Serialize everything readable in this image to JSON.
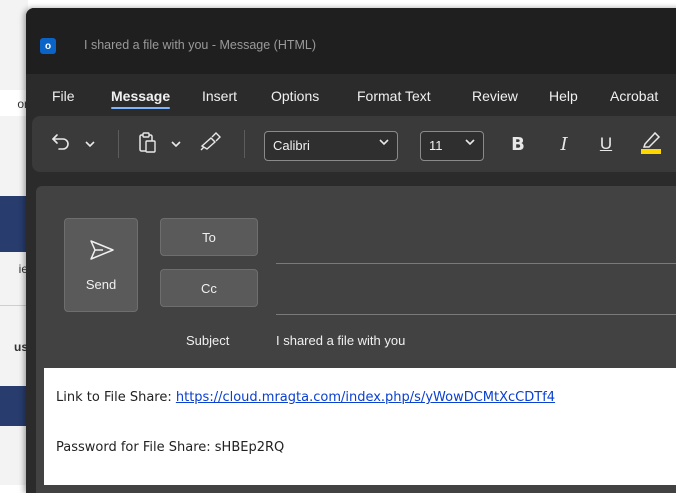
{
  "background_app": {
    "text_fragments": [
      "or",
      "ie",
      "us"
    ]
  },
  "window": {
    "title": "I shared a file with you  -  Message (HTML)",
    "app_icon_letter": "o"
  },
  "menu": {
    "items": [
      {
        "label": "File",
        "active": false
      },
      {
        "label": "Message",
        "active": true
      },
      {
        "label": "Insert",
        "active": false
      },
      {
        "label": "Options",
        "active": false
      },
      {
        "label": "Format Text",
        "active": false
      },
      {
        "label": "Review",
        "active": false
      },
      {
        "label": "Help",
        "active": false
      },
      {
        "label": "Acrobat",
        "active": false
      }
    ]
  },
  "toolbar": {
    "font_name": "Calibri",
    "font_size": "11",
    "bold_label": "B",
    "italic_label": "I",
    "underline_label": "U",
    "icons": [
      "undo-icon",
      "paste-icon",
      "format-painter-icon",
      "highlight-icon"
    ],
    "highlight_color": "#ffd700"
  },
  "compose": {
    "send_label": "Send",
    "to_label": "To",
    "cc_label": "Cc",
    "to_value": "",
    "cc_value": "",
    "subject_label": "Subject",
    "subject_value": "I shared a file with you"
  },
  "body": {
    "link_prefix": "Link to File Share: ",
    "link_url": "https://cloud.mragta.com/index.php/s/yWowDCMtXcCDTf4",
    "password_line": "Password for File Share: sHBEp2RQ"
  },
  "colors": {
    "accent": "#7fb5ff",
    "link": "#0b40d0",
    "window_bg": "#2b2b2b",
    "toolbar_bg": "#3a3a3a"
  }
}
